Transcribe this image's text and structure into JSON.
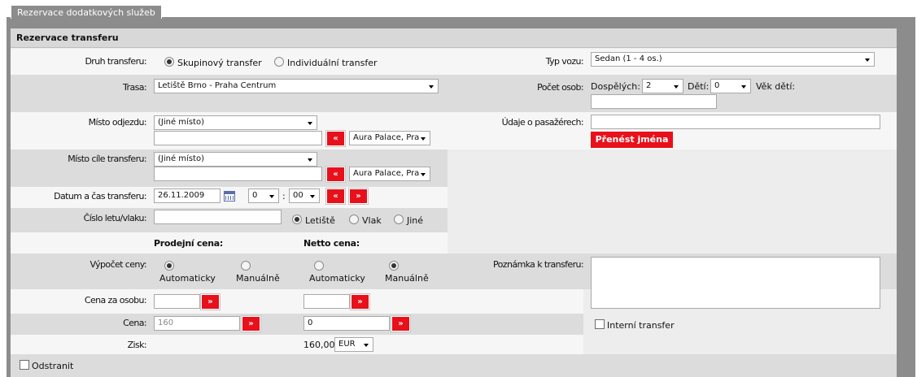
{
  "window": {
    "tab_title": "Rezervace dodatkových služeb",
    "panel_title": "Rezervace transferu"
  },
  "form": {
    "druh_transferu": {
      "label": "Druh transferu:",
      "options": [
        "Skupinový transfer",
        "Individuální transfer"
      ],
      "selected": "Skupinový transfer"
    },
    "typ_vozu": {
      "label": "Typ vozu:",
      "value": "Sedan (1 - 4 os.)"
    },
    "trasa": {
      "label": "Trasa:",
      "value": "Letiště Brno - Praha Centrum"
    },
    "pocet_osob": {
      "label": "Počet osob:",
      "dospelych_label": "Dospělých:",
      "dospelych": "2",
      "deti_label": "Dětí:",
      "deti": "0",
      "vek_deti_label": "Věk dětí:",
      "vek_deti": ""
    },
    "misto_odjezdu": {
      "label": "Místo odjezdu:",
      "select": "(Jiné místo)",
      "text": "",
      "hotel_select": "Aura Palace, Pra",
      "copy_button": "«"
    },
    "udaje_o_pasazerech": {
      "label": "Údaje o pasažérech:",
      "value": "",
      "button": "Přenést jména"
    },
    "misto_cile": {
      "label": "Místo cíle transferu:",
      "select": "(Jiné místo)",
      "text": "",
      "hotel_select": "Aura Palace, Pra",
      "copy_button": "«"
    },
    "datum_cas": {
      "label": "Datum a čas transferu:",
      "date": "26.11.2009",
      "hour": "0",
      "minute": "00",
      "separator": ":",
      "prev_button": "«",
      "next_button": "»"
    },
    "cislo_letu": {
      "label": "Číslo letu/vlaku:",
      "value": "",
      "options": [
        "Letiště",
        "Vlak",
        "Jiné"
      ],
      "selected": "Letiště"
    },
    "ceny": {
      "prodejni_header": "Prodejní cena:",
      "netto_header": "Netto cena:",
      "vypocet_label": "Výpočet ceny:",
      "prodejni_options": [
        "Automaticky",
        "Manuálně"
      ],
      "prodejni_selected": "Automaticky",
      "netto_options": [
        "Automaticky",
        "Manuálně"
      ],
      "netto_selected": "Manuálně",
      "cena_za_osobu_label": "Cena za osobu:",
      "cena_za_osobu_prodejni": "",
      "cena_za_osobu_netto": "",
      "cena_label": "Cena:",
      "cena_prodejni": "160",
      "cena_netto": "0",
      "apply_button": "»",
      "zisk_label": "Zisk:",
      "zisk_value": "160,00",
      "currency": "EUR"
    },
    "poznamka": {
      "label": "Poznámka k transferu:",
      "value": ""
    },
    "interni_transfer": {
      "label": "Interní transfer",
      "checked": false
    },
    "odstranit": {
      "label": "Odstranit",
      "checked": false
    }
  },
  "colors": {
    "accent_red": "#e8101a",
    "frame_gray": "#8c8c8c",
    "band_gray": "#dcdcdc"
  }
}
